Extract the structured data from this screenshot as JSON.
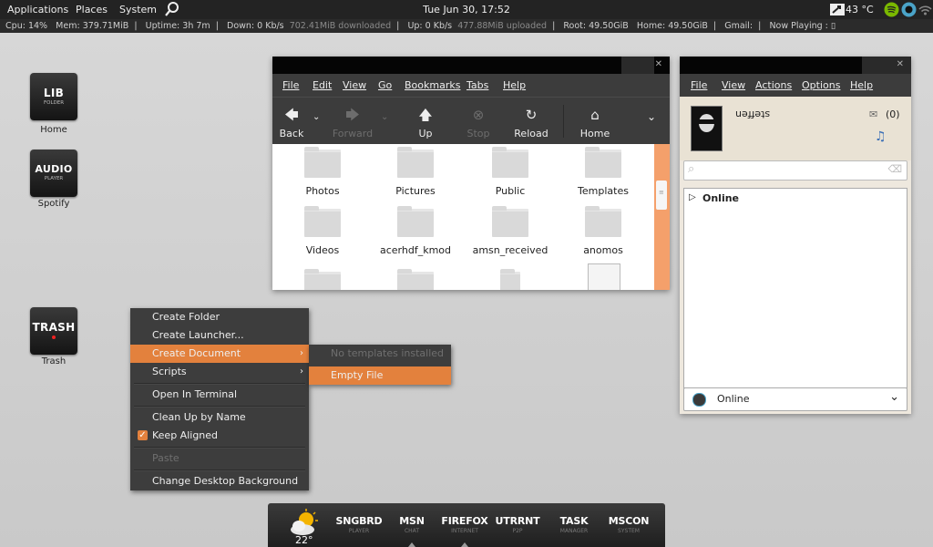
{
  "top_panel": {
    "menus": [
      "Applications",
      "Places",
      "System"
    ],
    "clock": "Tue Jun 30, 17:52",
    "temperature": "43 °C"
  },
  "conky": {
    "cpu_label": "Cpu:",
    "cpu_value": "14%",
    "mem_label": "Mem:",
    "mem_value": "379.71MiB",
    "uptime_label": "Uptime:",
    "uptime_value": "3h 7m",
    "down_label": "Down:",
    "down_value": "0 Kb/s",
    "downloaded": "702.41MiB downloaded",
    "up_label": "Up:",
    "up_value": "0 Kb/s",
    "uploaded": "477.88MiB uploaded",
    "root_label": "Root:",
    "root_value": "49.50GiB",
    "home_label": "Home:",
    "home_value": "49.50GiB",
    "gmail_label": "Gmail:",
    "nowplaying_label": "Now Playing :",
    "nowplaying_value": "▯"
  },
  "desktop_icons": [
    {
      "big": "LIB",
      "small": "FOLDER",
      "label": "Home"
    },
    {
      "big": "AUDIO",
      "small": "PLAYER",
      "label": "Spotify"
    },
    {
      "big": "TRASH",
      "small": "",
      "label": "Trash"
    }
  ],
  "file_manager": {
    "menu": [
      "File",
      "Edit",
      "View",
      "Go",
      "Bookmarks",
      "Tabs",
      "Help"
    ],
    "toolbar": {
      "back": "Back",
      "forward": "Forward",
      "up": "Up",
      "stop": "Stop",
      "reload": "Reload",
      "home": "Home"
    },
    "folders": [
      "Photos",
      "Pictures",
      "Public",
      "Templates",
      "Videos",
      "acerhdf_kmod",
      "amsn_received",
      "anomos"
    ]
  },
  "chat": {
    "menu": [
      "File",
      "View",
      "Actions",
      "Options",
      "Help"
    ],
    "username": "steffen",
    "mail_count": "(0)",
    "group": "Online",
    "status": "Online"
  },
  "context_menu": {
    "items": [
      "Create Folder",
      "Create Launcher...",
      "Create Document",
      "Scripts",
      "Open In Terminal",
      "Clean Up by Name",
      "Keep Aligned",
      "Paste",
      "Change Desktop Background"
    ],
    "submenu": [
      "No templates installed",
      "Empty File"
    ]
  },
  "dock": {
    "weather_temp": "22°",
    "items": [
      {
        "name": "SNGBRD",
        "sub": "PLAYER"
      },
      {
        "name": "MSN",
        "sub": "CHAT"
      },
      {
        "name": "FIREFOX",
        "sub": "INTERNET"
      },
      {
        "name": "UTRRNT",
        "sub": "P2P"
      },
      {
        "name": "TASK",
        "sub": "MANAGER"
      },
      {
        "name": "MSCON",
        "sub": "SYSTEM"
      }
    ]
  }
}
